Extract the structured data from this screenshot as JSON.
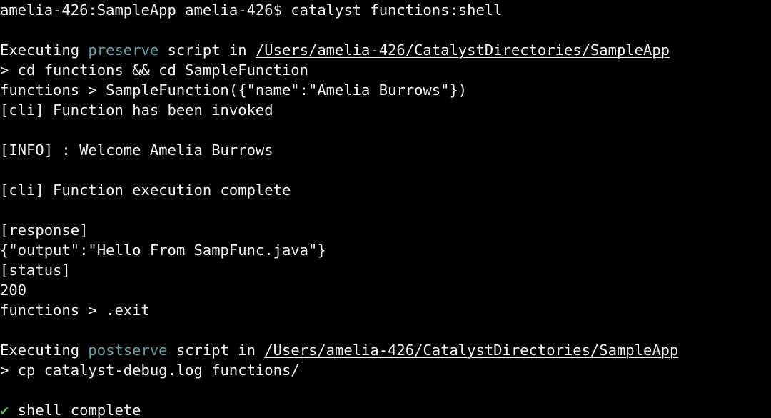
{
  "terminal": {
    "window_title": "Terminal",
    "background_color": "#000000",
    "foreground_color": "#f2f2f2",
    "accent_script_color": "#62a0a8",
    "success_color": "#55bb55",
    "prompt_host": "amelia-426",
    "prompt_dir": "SampleApp",
    "prompt_user": "amelia-426",
    "command": "catalyst functions:shell",
    "lines": [
      {
        "id": "prompt-line",
        "segments": [
          {
            "text": "amelia-426:SampleApp amelia-426$ catalyst functions:shell",
            "style": "default"
          }
        ]
      },
      {
        "id": "blank-1",
        "segments": []
      },
      {
        "id": "preserve-exec-line",
        "segments": [
          {
            "text": "Executing ",
            "style": "default"
          },
          {
            "text": "preserve",
            "style": "script"
          },
          {
            "text": " script in ",
            "style": "default"
          },
          {
            "text": "/Users/amelia-426/CatalystDirectories/SampleApp",
            "style": "path"
          }
        ]
      },
      {
        "id": "cd-command-line",
        "segments": [
          {
            "text": "> cd functions && cd SampleFunction",
            "style": "default"
          }
        ]
      },
      {
        "id": "function-invoke-line",
        "segments": [
          {
            "text": "functions > SampleFunction({\"name\":\"Amelia Burrows\"})",
            "style": "default"
          }
        ]
      },
      {
        "id": "cli-invoked-line",
        "segments": [
          {
            "text": "[cli] Function has been invoked",
            "style": "default"
          }
        ]
      },
      {
        "id": "blank-2",
        "segments": []
      },
      {
        "id": "info-welcome-line",
        "segments": [
          {
            "text": "[INFO] : Welcome Amelia Burrows",
            "style": "default"
          }
        ]
      },
      {
        "id": "blank-3",
        "segments": []
      },
      {
        "id": "cli-complete-line",
        "segments": [
          {
            "text": "[cli] Function execution complete",
            "style": "default"
          }
        ]
      },
      {
        "id": "blank-4",
        "segments": []
      },
      {
        "id": "response-header-line",
        "segments": [
          {
            "text": "[response]",
            "style": "default"
          }
        ]
      },
      {
        "id": "response-body-line",
        "segments": [
          {
            "text": "{\"output\":\"Hello From SampFunc.java\"}",
            "style": "default"
          }
        ]
      },
      {
        "id": "status-header-line",
        "segments": [
          {
            "text": "[status]",
            "style": "default"
          }
        ]
      },
      {
        "id": "status-code-line",
        "segments": [
          {
            "text": "200",
            "style": "default"
          }
        ]
      },
      {
        "id": "exit-command-line",
        "segments": [
          {
            "text": "functions > .exit",
            "style": "default"
          }
        ]
      },
      {
        "id": "blank-5",
        "segments": []
      },
      {
        "id": "postserve-exec-line",
        "segments": [
          {
            "text": "Executing ",
            "style": "default"
          },
          {
            "text": "postserve",
            "style": "script"
          },
          {
            "text": " script in ",
            "style": "default"
          },
          {
            "text": "/Users/amelia-426/CatalystDirectories/SampleApp",
            "style": "path"
          }
        ]
      },
      {
        "id": "cp-command-line",
        "segments": [
          {
            "text": "> cp catalyst-debug.log functions/",
            "style": "default"
          }
        ]
      },
      {
        "id": "blank-6",
        "segments": []
      },
      {
        "id": "shell-complete-line",
        "segments": [
          {
            "text": "✔",
            "style": "ok"
          },
          {
            "text": " shell complete",
            "style": "default"
          }
        ]
      }
    ]
  }
}
